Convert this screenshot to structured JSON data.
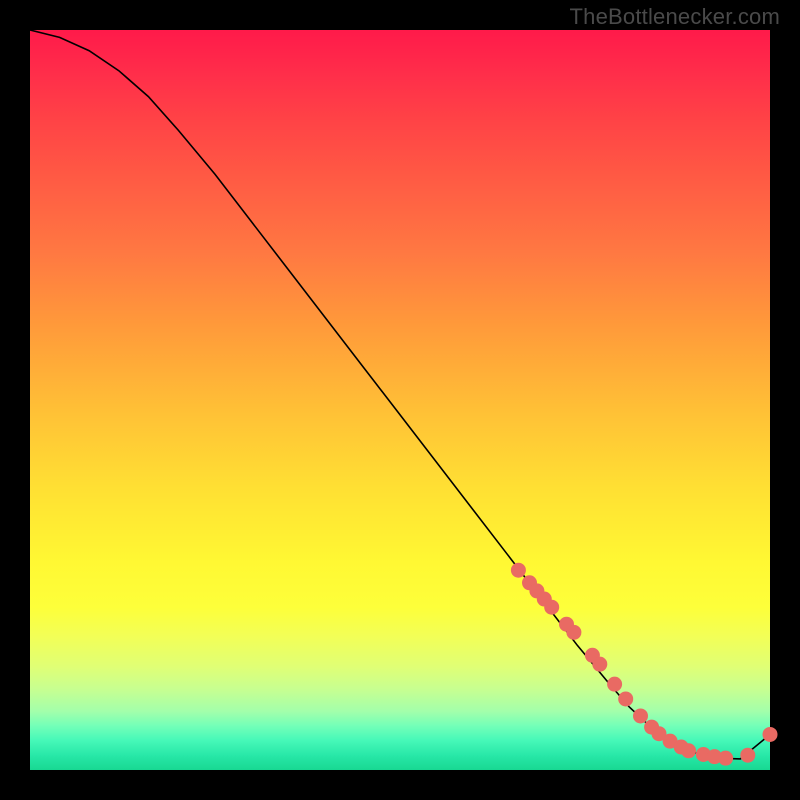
{
  "attribution": "TheBottlenecker.com",
  "chart_data": {
    "type": "line",
    "title": "",
    "xlabel": "",
    "ylabel": "",
    "xlim": [
      0,
      100
    ],
    "ylim": [
      0,
      100
    ],
    "series": [
      {
        "name": "curve",
        "x": [
          0,
          4,
          8,
          12,
          16,
          20,
          25,
          30,
          35,
          40,
          45,
          50,
          55,
          60,
          65,
          70,
          74,
          78,
          81,
          84,
          87,
          90,
          93,
          96,
          100
        ],
        "y": [
          100,
          99,
          97.2,
          94.5,
          91,
          86.5,
          80.5,
          74,
          67.5,
          61,
          54.5,
          48,
          41.5,
          35,
          28.5,
          22,
          16.8,
          12,
          8.5,
          5.7,
          3.7,
          2.3,
          1.6,
          1.5,
          4.8
        ]
      }
    ],
    "highlighted_points": {
      "name": "dots",
      "x": [
        66,
        67.5,
        68.5,
        69.5,
        70.5,
        72.5,
        73.5,
        76,
        77,
        79,
        80.5,
        82.5,
        84,
        85,
        86.5,
        88,
        89,
        91,
        92.5,
        94,
        97,
        100
      ],
      "y": [
        27,
        25.3,
        24.2,
        23.1,
        22,
        19.7,
        18.6,
        15.5,
        14.3,
        11.6,
        9.6,
        7.3,
        5.8,
        4.9,
        3.9,
        3.1,
        2.6,
        2.1,
        1.8,
        1.6,
        2.0,
        4.8
      ]
    }
  }
}
